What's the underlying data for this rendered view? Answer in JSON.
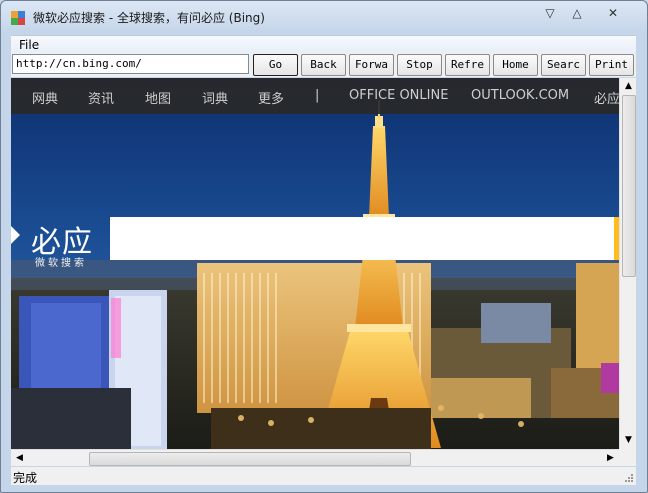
{
  "window": {
    "title": "微软必应搜索 - 全球搜索，有问必应 (Bing)",
    "minimize_glyph": "▽",
    "maximize_glyph": "△",
    "close_glyph": "✕"
  },
  "menu": {
    "file_label": "File"
  },
  "toolbar": {
    "url_value": "http://cn.bing.com/",
    "buttons": [
      "Go",
      "Back",
      "Forwa",
      "Stop",
      "Refre",
      "Home",
      "Searc",
      "Print"
    ]
  },
  "page": {
    "nav_items": [
      "网典",
      "资讯",
      "地图",
      "词典",
      "更多",
      "|",
      "OFFICE ONLINE",
      "OUTLOOK.COM",
      "必应"
    ],
    "brand_main": "必应",
    "brand_sub": "微软搜索",
    "search_value": ""
  },
  "scrollbars": {
    "up_glyph": "▲",
    "down_glyph": "▼",
    "left_glyph": "◀",
    "right_glyph": "▶"
  },
  "status": {
    "text": "完成"
  },
  "colors": {
    "accent": "#ffbe1e",
    "nav_bg": "#2b2b2b"
  }
}
